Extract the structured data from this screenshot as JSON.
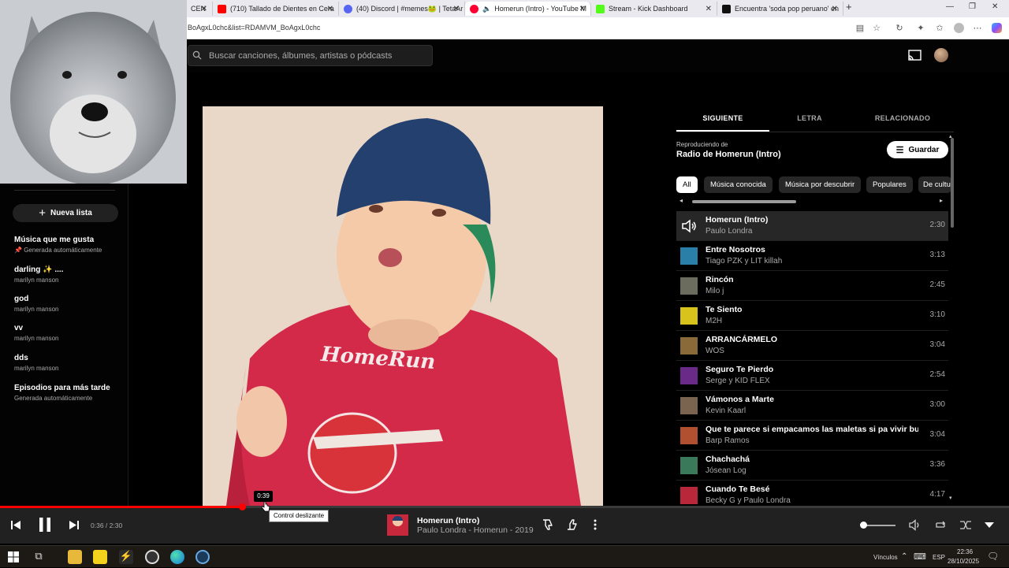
{
  "browser": {
    "tabs": [
      {
        "label": "CEN",
        "favicon_color": "#888888"
      },
      {
        "label": "(710) Tallado de Dientes en Cera",
        "favicon_color": "#ff0000"
      },
      {
        "label": "(40) Discord | #memes🐸 | TetaAr",
        "favicon_color": "#5865f2"
      },
      {
        "label": "Homerun (Intro) - YouTube M",
        "favicon_color": "#ff0033"
      },
      {
        "label": "Stream - Kick Dashboard",
        "favicon_color": "#53fc18"
      },
      {
        "label": "Encuentra 'soda pop peruano' en",
        "favicon_color": "#111111"
      }
    ],
    "url": "BoAgxL0chc&list=RDAMVM_BoAgxL0chc"
  },
  "header": {
    "search_placeholder": "Buscar canciones, álbumes, artistas o pódcasts"
  },
  "sidebar": {
    "new_list_label": "Nueva lista",
    "playlists": [
      {
        "title": "Música que me gusta",
        "subtitle": "Generada automáticamente",
        "pinned": true
      },
      {
        "title": "darling ✨ ....",
        "subtitle": "marilyn manson"
      },
      {
        "title": "god",
        "subtitle": "marilyn manson"
      },
      {
        "title": "vv",
        "subtitle": "marilyn manson"
      },
      {
        "title": "dds",
        "subtitle": "marilyn manson"
      },
      {
        "title": "Episodios para más tarde",
        "subtitle": "Generada automáticamente"
      }
    ]
  },
  "album_art": {
    "text": "HomeRun"
  },
  "right_panel": {
    "tabs": [
      "SIGUIENTE",
      "LETRA",
      "RELACIONADO"
    ],
    "active_tab": 0,
    "playing_from_label": "Reproduciendo de",
    "playing_from_title": "Radio de Homerun (Intro)",
    "save_label": "Guardar",
    "chips": [
      "All",
      "Música conocida",
      "Música por descubrir",
      "Populares",
      "De cultu"
    ],
    "queue": [
      {
        "title": "Homerun (Intro)",
        "artist": "Paulo Londra",
        "duration": "2:30",
        "playing": true,
        "color": "#3a3a3a"
      },
      {
        "title": "Entre Nosotros",
        "artist": "Tiago PZK y LIT killah",
        "duration": "3:13",
        "color": "#2a7fa8"
      },
      {
        "title": "Rincón",
        "artist": "Milo j",
        "duration": "2:45",
        "color": "#6b6b5e"
      },
      {
        "title": "Te Siento",
        "artist": "M2H",
        "duration": "3:10",
        "color": "#d8c21c"
      },
      {
        "title": "ARRANCÁRMELO",
        "artist": "WOS",
        "duration": "3:04",
        "color": "#8a6a38"
      },
      {
        "title": "Seguro Te Pierdo",
        "artist": "Serge y KID FLEX",
        "duration": "2:54",
        "color": "#6a2a88"
      },
      {
        "title": "Vámonos a Marte",
        "artist": "Kevin Kaarl",
        "duration": "3:00",
        "color": "#7a6450"
      },
      {
        "title": "Que te parece si empacamos las maletas si pa vivir bu...",
        "artist": "Barp Ramos",
        "duration": "3:04",
        "color": "#b05030"
      },
      {
        "title": "Chachachá",
        "artist": "Jósean Log",
        "duration": "3:36",
        "color": "#3a7a5a"
      },
      {
        "title": "Cuando Te Besé",
        "artist": "Becky G y Paulo Londra",
        "duration": "4:17",
        "color": "#b8283a"
      }
    ]
  },
  "player": {
    "time_display": "0:36 / 2:30",
    "progress_fraction": 0.24,
    "hover_time": "0:39",
    "tooltip": "Control deslizante",
    "now_playing_title": "Homerun (Intro)",
    "now_playing_subtitle": "Paulo Londra - Homerun - 2019",
    "volume_fraction": 0.0,
    "accent": "#ff0000"
  },
  "taskbar": {
    "links_label": "Vínculos",
    "lang": "ESP",
    "time": "22:36",
    "date": "28/10/2025"
  }
}
